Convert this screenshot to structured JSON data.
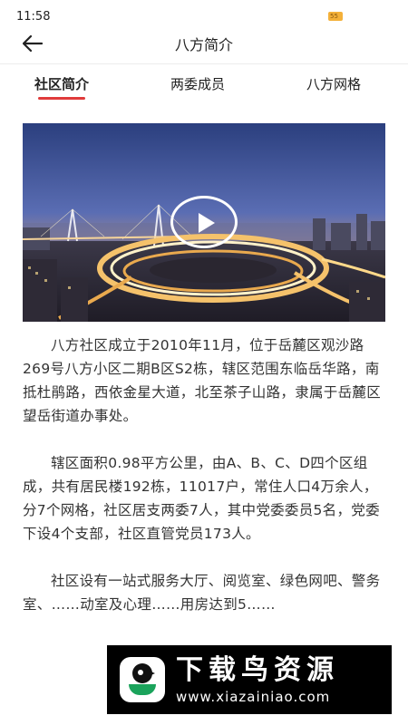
{
  "status_bar": {
    "time": "11:58",
    "battery": "55",
    "battery_color": "#f4b13a"
  },
  "header": {
    "title": "八方简介",
    "back_icon": "arrow-left-icon"
  },
  "tabs": [
    {
      "label": "社区简介",
      "active": true
    },
    {
      "label": "两委成员",
      "active": false
    },
    {
      "label": "八方网格",
      "active": false
    }
  ],
  "accent_color": "#e03a3a",
  "video": {
    "play_icon": "play-icon"
  },
  "paragraphs": [
    "八方社区成立于2010年11月，位于岳麓区观沙路269号八方小区二期B区S2栋，辖区范围东临岳华路，南抵杜鹃路，西依金星大道，北至茶子山路，隶属于岳麓区望岳街道办事处。",
    "辖区面积0.98平方公里，由A、B、C、D四个区组成，共有居民楼192栋，11017户，常住人口4万余人，分7个网格，社区居支两委7人，其中党委委员5名，党委下设4个支部，社区直管党员173人。",
    "社区设有一站式服务大厅、阅览室、绿色网吧、警务室、……动室及心理……用房达到5……"
  ],
  "watermark": {
    "name": "下载鸟资源",
    "url": "www.xiazainiao.com"
  }
}
